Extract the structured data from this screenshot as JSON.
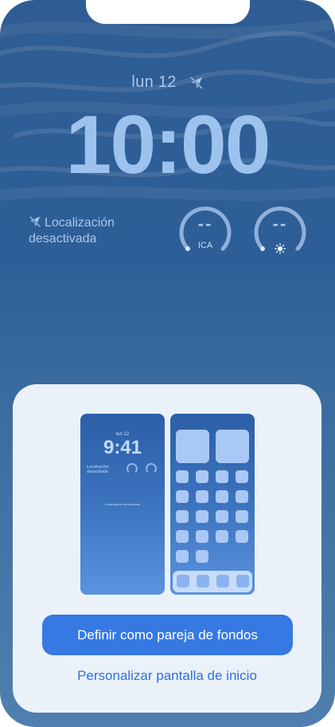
{
  "lockscreen": {
    "date": "lun 12",
    "time": "10:00",
    "location_line1": "Localización",
    "location_line2": "desactivada",
    "gauge_aqi": {
      "value": "--",
      "label": "ICA"
    },
    "gauge_uv": {
      "value": "--",
      "icon": "sun-icon"
    }
  },
  "sheet": {
    "preview_lock": {
      "date": "lun 12",
      "time": "9:41",
      "location_line1": "Localización",
      "location_line2": "desactivada",
      "center_text": "Localización desactivada"
    },
    "primary_button": "Definir como pareja de fondos",
    "secondary_link": "Personalizar pantalla de inicio"
  },
  "colors": {
    "accent": "#3679e2",
    "link": "#2f72d7",
    "sheet_bg": "#eaf1f9",
    "wallpaper_top": "#2f5d93",
    "wallpaper_bottom": "#4f7fae"
  },
  "icons": [
    "location-disabled-icon",
    "sun-icon"
  ]
}
